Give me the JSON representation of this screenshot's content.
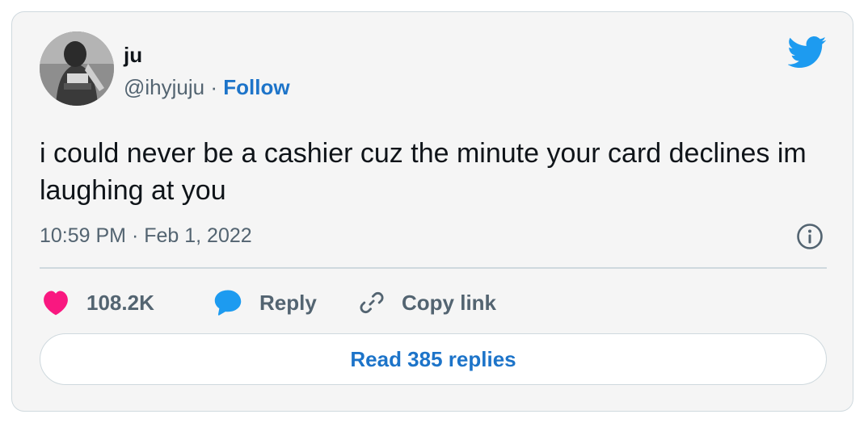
{
  "tweet": {
    "author": {
      "name": "ju",
      "handle": "@ihyjuju",
      "separator": "·",
      "follow_label": "Follow"
    },
    "text": "i could never be a cashier cuz the minute your card declines im laughing at you",
    "timestamp": "10:59 PM · Feb 1, 2022"
  },
  "actions": {
    "like_count": "108.2K",
    "reply_label": "Reply",
    "copy_link_label": "Copy link"
  },
  "read_replies_label": "Read 385 replies",
  "icons": {
    "brand": "twitter-bird-icon",
    "info": "info-icon",
    "like": "heart-icon",
    "reply": "speech-bubble-icon",
    "copy": "link-icon"
  },
  "colors": {
    "accent": "#1d74c9",
    "twitter_blue": "#1d9bf0",
    "like_pink": "#f91880",
    "secondary_text": "#536471",
    "card_background": "#f5f5f5",
    "border": "#cfd9de"
  }
}
